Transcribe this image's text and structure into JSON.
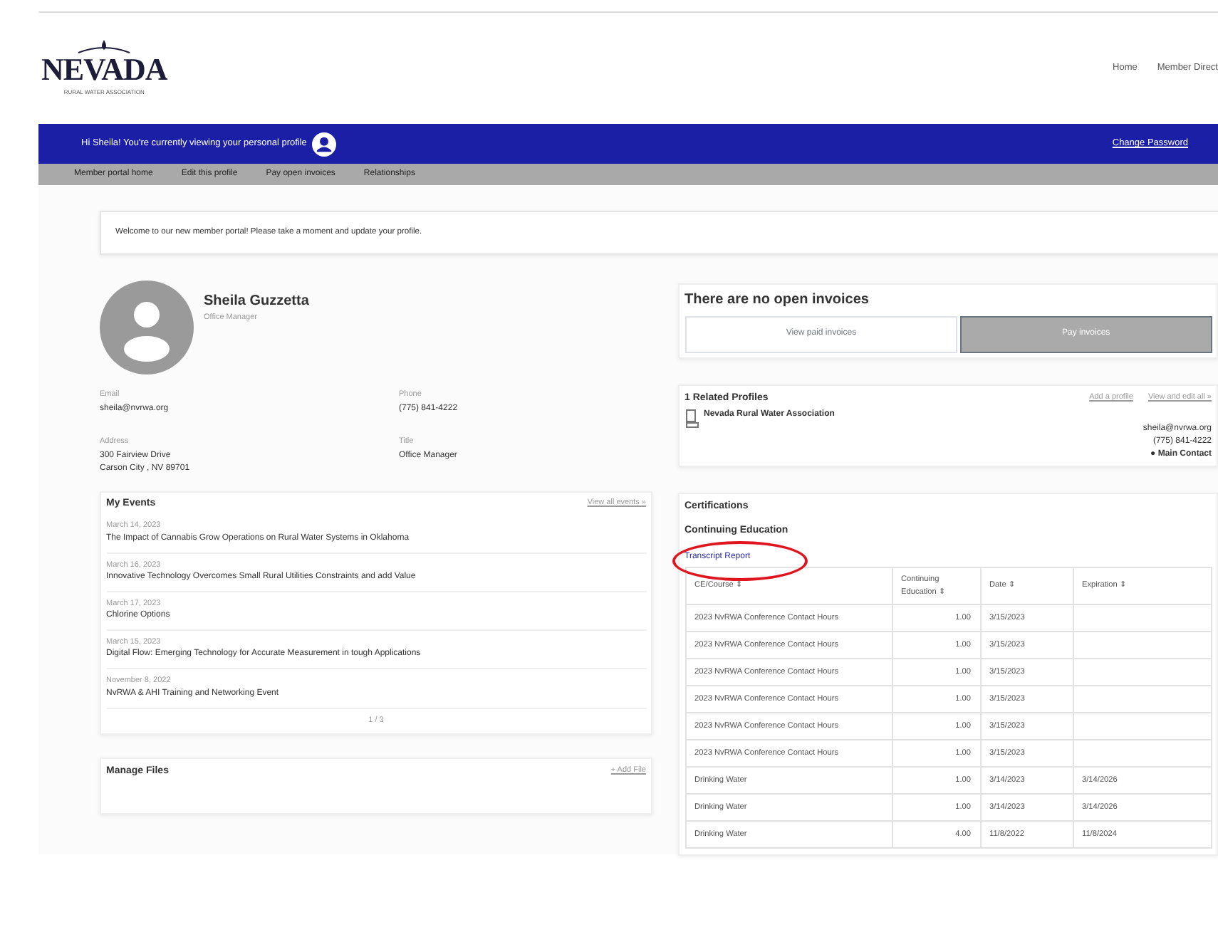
{
  "header": {
    "logo": {
      "name": "NEVADA",
      "tagline": "RURAL WATER ASSOCIATION"
    },
    "links": [
      "Home",
      "Member Direct"
    ]
  },
  "user_bar": {
    "greeting": "Hi Sheila!  You're currently viewing your personal profile",
    "links": [
      "Change Password"
    ]
  },
  "sub_nav": [
    "Member portal home",
    "Edit this profile",
    "Pay open invoices",
    "Relationships"
  ],
  "welcome": "Welcome to our new member portal!  Please take a moment and update your profile.",
  "profile": {
    "name": "Sheila Guzzetta",
    "role": "Office Manager",
    "fields": [
      {
        "label": "Email",
        "lines": [
          "sheila@nvrwa.org"
        ]
      },
      {
        "label": "Phone",
        "lines": [
          "(775) 841-4222"
        ]
      },
      {
        "label": "Address",
        "lines": [
          "300 Fairview Drive",
          "Carson City , NV 89701"
        ]
      },
      {
        "label": "Title",
        "lines": [
          "Office Manager"
        ]
      }
    ]
  },
  "events": {
    "title": "My Events",
    "link": "View all events »",
    "items": [
      {
        "date": "March 14, 2023",
        "title": "The Impact of Cannabis Grow Operations on Rural Water Systems in Oklahoma"
      },
      {
        "date": "March 16, 2023",
        "title": "Innovative Technology Overcomes Small Rural Utilities Constraints and add Value"
      },
      {
        "date": "March 17, 2023",
        "title": "Chlorine Options"
      },
      {
        "date": "March 15, 2023",
        "title": "Digital Flow: Emerging Technology for Accurate Measurement in tough Applications"
      },
      {
        "date": "November 8, 2022",
        "title": "NvRWA & AHI Training and Networking Event"
      }
    ],
    "pager": "1 / 3"
  },
  "files": {
    "title": "Manage Files",
    "link": "+ Add File"
  },
  "invoices": {
    "title": "There are no open invoices",
    "buttons": [
      {
        "label": "View paid invoices",
        "disabled": false
      },
      {
        "label": "Pay invoices",
        "disabled": true
      }
    ]
  },
  "related": {
    "title": "1 Related Profiles",
    "links": [
      "Add a profile",
      "View and edit all »"
    ],
    "items": [
      {
        "name": "Nevada Rural Water Association",
        "email": "sheila@nvrwa.org",
        "phone": "(775) 841-4222",
        "role": "● Main Contact"
      }
    ]
  },
  "certifications": {
    "title": "Certifications",
    "subtitle": "Continuing Education",
    "report_link": {
      "label": "Transcript Report",
      "circled": true
    },
    "columns": [
      "CE/Course ⇕",
      "Continuing Education ⇕",
      "Date ⇕",
      "Expiration ⇕"
    ],
    "rows": [
      {
        "course": "2023 NvRWA Conference Contact Hours",
        "hours": "1.00",
        "date": "3/15/2023"
      },
      {
        "course": "2023 NvRWA Conference Contact Hours",
        "hours": "1.00",
        "date": "3/15/2023"
      },
      {
        "course": "2023 NvRWA Conference Contact Hours",
        "hours": "1.00",
        "date": "3/15/2023"
      },
      {
        "course": "2023 NvRWA Conference Contact Hours",
        "hours": "1.00",
        "date": "3/15/2023"
      },
      {
        "course": "2023 NvRWA Conference Contact Hours",
        "hours": "1.00",
        "date": "3/15/2023"
      },
      {
        "course": "2023 NvRWA Conference Contact Hours",
        "hours": "1.00",
        "date": "3/15/2023"
      },
      {
        "course": "Drinking Water",
        "hours": "1.00",
        "date": "3/14/2023",
        "expiration": "3/14/2026"
      },
      {
        "course": "Drinking Water",
        "hours": "1.00",
        "date": "3/14/2023",
        "expiration": "3/14/2026"
      },
      {
        "course": "Drinking Water",
        "hours": "4.00",
        "date": "11/8/2022",
        "expiration": "11/8/2024"
      }
    ]
  }
}
